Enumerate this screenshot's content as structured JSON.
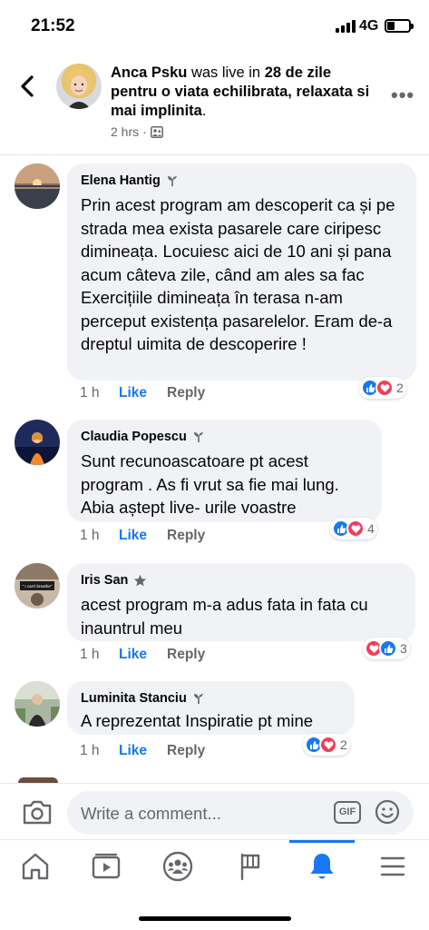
{
  "status_bar": {
    "time": "21:52",
    "network": "4G"
  },
  "header": {
    "name": "Anca Psku",
    "action": "was live in",
    "group": "28 de zile pentru o viata echilibrata, relaxata si mai implinita",
    "group_end": ".",
    "timestamp": "2 hrs",
    "separator": "·"
  },
  "comments": [
    {
      "name": "Elena Hantig",
      "badge": "plant-badge-icon",
      "text": "Prin acest program am descoperit ca și pe strada mea exista pasarele care ciripesc dimineața. Locuiesc aici de 10 ani și pana acum câteva zile, când am ales sa fac Exercițiile dimineața în terasa n-am perceput existența pasarelelor. Eram de-a dreptul uimita de descoperire !",
      "time": "1 h",
      "like": "Like",
      "reply": "Reply",
      "reaction_count": "2"
    },
    {
      "name": "Claudia Popescu",
      "badge": "plant-badge-icon",
      "text": "Sunt recunoascatoare pt acest program . As fi vrut sa fie mai lung. Abia aștept live- urile voastre",
      "time": "1 h",
      "like": "Like",
      "reply": "Reply",
      "reaction_count": "4"
    },
    {
      "name": "Iris San",
      "badge": "star-badge-icon",
      "avatar_text": "\" I can't breathe\"",
      "text": "acest program m-a adus fata in fata cu inauntrul meu",
      "time": "1 h",
      "like": "Like",
      "reply": "Reply",
      "reaction_count": "3"
    },
    {
      "name": "Luminita Stanciu",
      "badge": "plant-badge-icon",
      "text": "A reprezentat Inspiratie pt mine",
      "time": "1 h",
      "like": "Like",
      "reply": "Reply",
      "reaction_count": "2"
    }
  ],
  "composer": {
    "placeholder": "Write a comment...",
    "gif_label": "GIF"
  },
  "tabs": [
    "home-icon",
    "watch-icon",
    "groups-icon",
    "pages-flag-icon",
    "notifications-bell-icon",
    "menu-icon"
  ],
  "colors": {
    "accent": "#1877f2",
    "love": "#f33e58",
    "bubble": "#f0f2f5",
    "secondary_text": "#65676b"
  }
}
